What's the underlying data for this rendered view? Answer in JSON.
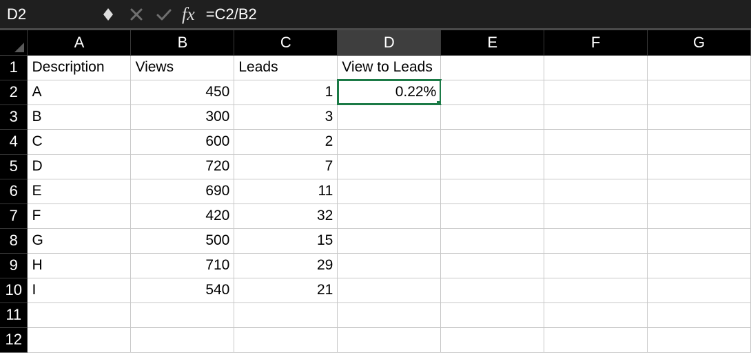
{
  "name_box": "D2",
  "formula": "=C2/B2",
  "fx_label": "fx",
  "columns": [
    "A",
    "B",
    "C",
    "D",
    "E",
    "F",
    "G"
  ],
  "row_numbers": [
    "1",
    "2",
    "3",
    "4",
    "5",
    "6",
    "7",
    "8",
    "9",
    "10",
    "11",
    "12"
  ],
  "headers": {
    "A": "Description",
    "B": "Views",
    "C": "Leads",
    "D": "View to Leads"
  },
  "rows": [
    {
      "A": "A",
      "B": "450",
      "C": "1",
      "D": "0.22%"
    },
    {
      "A": "B",
      "B": "300",
      "C": "3",
      "D": ""
    },
    {
      "A": "C",
      "B": "600",
      "C": "2",
      "D": ""
    },
    {
      "A": "D",
      "B": "720",
      "C": "7",
      "D": ""
    },
    {
      "A": "E",
      "B": "690",
      "C": "11",
      "D": ""
    },
    {
      "A": "F",
      "B": "420",
      "C": "32",
      "D": ""
    },
    {
      "A": "G",
      "B": "500",
      "C": "15",
      "D": ""
    },
    {
      "A": "H",
      "B": "710",
      "C": "29",
      "D": ""
    },
    {
      "A": "I",
      "B": "540",
      "C": "21",
      "D": ""
    }
  ],
  "selected_cell": "D2",
  "active_column": "D"
}
